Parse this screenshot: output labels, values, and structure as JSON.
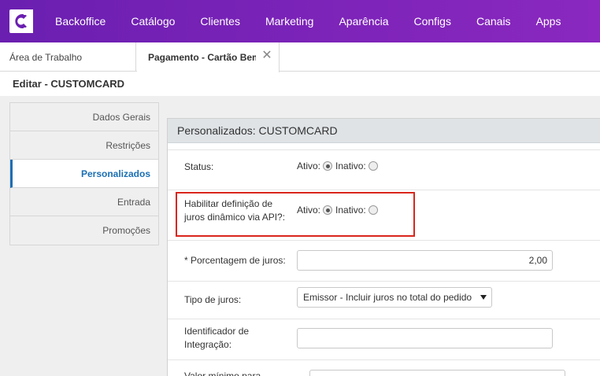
{
  "nav": {
    "items": [
      "Backoffice",
      "Catálogo",
      "Clientes",
      "Marketing",
      "Aparência",
      "Configs",
      "Canais",
      "Apps"
    ]
  },
  "tabs": {
    "home_label": "Área de Trabalho",
    "active_label": "Pagamento - Cartão Bem",
    "close_glyph": "✕"
  },
  "page": {
    "title": "Editar - CUSTOMCARD"
  },
  "sidebar": {
    "items": [
      {
        "label": "Dados Gerais"
      },
      {
        "label": "Restrições"
      },
      {
        "label": "Personalizados"
      },
      {
        "label": "Entrada"
      },
      {
        "label": "Promoções"
      }
    ],
    "active_index": 2
  },
  "panel": {
    "header": "Personalizados: CUSTOMCARD",
    "status": {
      "label": "Status:",
      "option_active": "Ativo:",
      "option_inactive": "Inativo:",
      "selected": "active"
    },
    "dynamic_interest": {
      "label_line1": "Habilitar definição de",
      "label_line2": "juros dinâmico via API?:",
      "option_active": "Ativo:",
      "option_inactive": "Inativo:",
      "selected": "active"
    },
    "interest_percent": {
      "label": "* Porcentagem de juros:",
      "value": "2,00"
    },
    "interest_type": {
      "label": "Tipo de juros:",
      "selected": "Emissor - Incluir juros no total do pedido"
    },
    "integration_id": {
      "label_line1": "Identificador de",
      "label_line2": "Integração:",
      "value": ""
    },
    "min_value": {
      "label": "Valor mínimo para"
    }
  },
  "colors": {
    "nav_bg": "#7b23b8",
    "active_side": "#1b6fb3",
    "highlight": "#d9261c"
  }
}
